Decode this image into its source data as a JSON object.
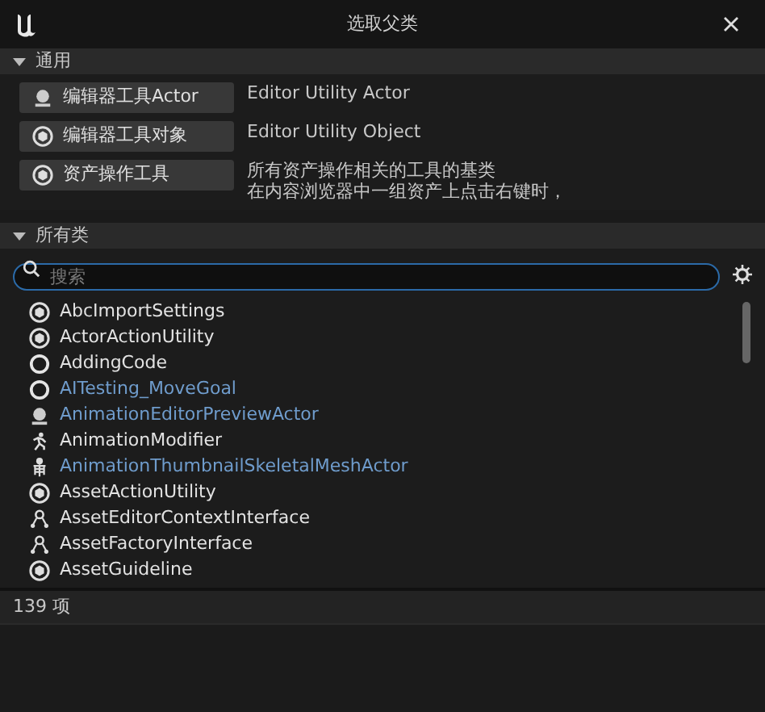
{
  "window": {
    "title": "选取父类"
  },
  "common": {
    "label": "通用",
    "expanded": true,
    "items": [
      {
        "kind": "actor",
        "button": "编辑器工具Actor",
        "description": "Editor Utility Actor"
      },
      {
        "kind": "class",
        "button": "编辑器工具对象",
        "description": "Editor Utility Object"
      },
      {
        "kind": "class",
        "button": "资产操作工具",
        "description_lines": [
          "所有资产操作相关的工具的基类",
          "在内容浏览器中一组资产上点击右键时，"
        ]
      }
    ]
  },
  "all_classes": {
    "label": "所有类",
    "expanded": true,
    "search": {
      "placeholder": "搜索"
    },
    "items": [
      {
        "kind": "class",
        "name": "AbcImportSettings",
        "blueprint": false
      },
      {
        "kind": "class",
        "name": "ActorActionUtility",
        "blueprint": false
      },
      {
        "kind": "ring",
        "name": "AddingCode",
        "blueprint": false
      },
      {
        "kind": "ring",
        "name": "AITesting_MoveGoal",
        "blueprint": true
      },
      {
        "kind": "actor",
        "name": "AnimationEditorPreviewActor",
        "blueprint": true
      },
      {
        "kind": "anim",
        "name": "AnimationModifier",
        "blueprint": false
      },
      {
        "kind": "skeleton",
        "name": "AnimationThumbnailSkeletalMeshActor",
        "blueprint": true
      },
      {
        "kind": "class",
        "name": "AssetActionUtility",
        "blueprint": false
      },
      {
        "kind": "interface",
        "name": "AssetEditorContextInterface",
        "blueprint": false
      },
      {
        "kind": "interface",
        "name": "AssetFactoryInterface",
        "blueprint": false
      },
      {
        "kind": "class",
        "name": "AssetGuideline",
        "blueprint": false
      }
    ],
    "count": "139 项"
  }
}
